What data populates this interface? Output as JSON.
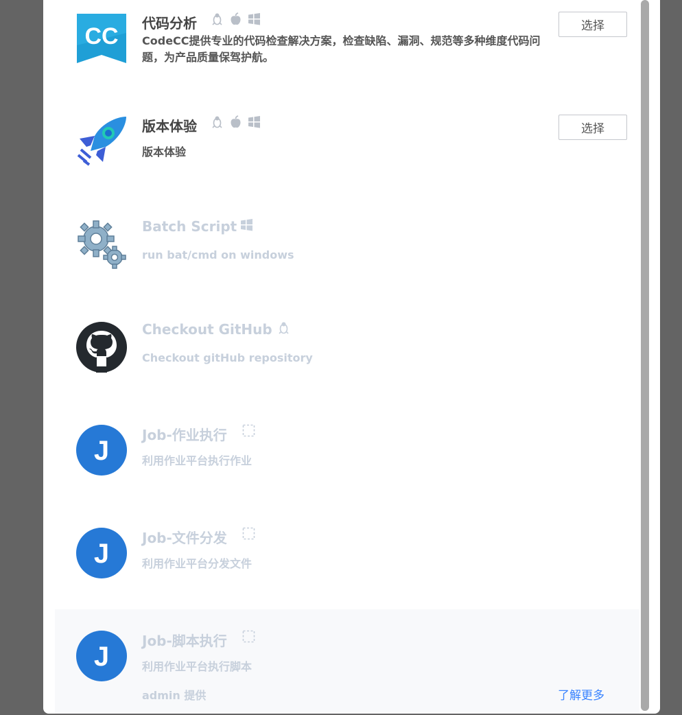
{
  "plugins": [
    {
      "name": "代码分析",
      "desc": "CodeCC提供专业的代码检查解决方案，检查缺陷、漏洞、规范等多种维度代码问题，为产品质量保驾护航。",
      "os": [
        "linux-icon",
        "apple-icon",
        "windows-icon"
      ],
      "enabled": true,
      "action": "选择"
    },
    {
      "name": "版本体验",
      "desc": "版本体验",
      "os": [
        "linux-icon",
        "apple-icon",
        "windows-icon"
      ],
      "enabled": true,
      "action": "选择"
    },
    {
      "name": "Batch Script",
      "desc": "run bat/cmd on windows",
      "os": [
        "windows-icon"
      ],
      "enabled": false
    },
    {
      "name": "Checkout GitHub",
      "desc": "Checkout gitHub repository",
      "os": [
        "linux-icon"
      ],
      "enabled": false
    },
    {
      "name": "Job-作业执行",
      "desc": "利用作业平台执行作业",
      "os": [
        "agentless-icon"
      ],
      "enabled": false
    },
    {
      "name": "Job-文件分发",
      "desc": "利用作业平台分发文件",
      "os": [
        "agentless-icon"
      ],
      "enabled": false
    },
    {
      "name": "Job-脚本执行",
      "desc": "利用作业平台执行脚本",
      "os": [
        "agentless-icon"
      ],
      "enabled": false,
      "provider": "admin 提供",
      "more": "了解更多"
    }
  ],
  "colors": {
    "accent": "#3a84ff",
    "disabled": "#c7d0dc",
    "job_blue": "#2679d6"
  }
}
